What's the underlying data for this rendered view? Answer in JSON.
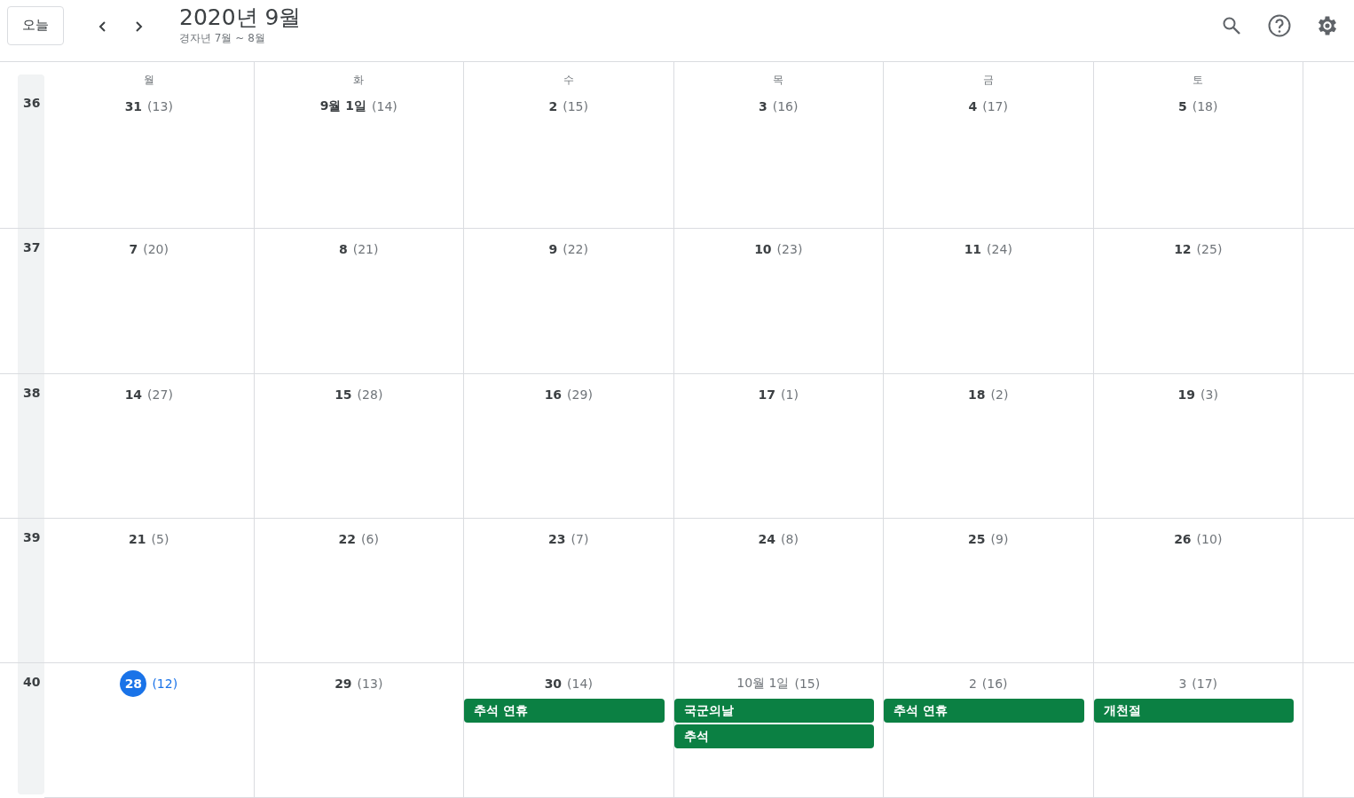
{
  "toolbar": {
    "today_button": "오늘",
    "title": "2020년 9월",
    "subtitle": "경자년 7월 ~ 8월"
  },
  "weekdays": [
    "월",
    "화",
    "수",
    "목",
    "금",
    "토"
  ],
  "weeks": [
    {
      "number": "36",
      "days": [
        {
          "day": "31",
          "lunar": "(13)",
          "today": false,
          "other_month": false
        },
        {
          "day": "9월 1일",
          "lunar": "(14)",
          "today": false,
          "other_month": false
        },
        {
          "day": "2",
          "lunar": "(15)",
          "today": false,
          "other_month": false
        },
        {
          "day": "3",
          "lunar": "(16)",
          "today": false,
          "other_month": false
        },
        {
          "day": "4",
          "lunar": "(17)",
          "today": false,
          "other_month": false
        },
        {
          "day": "5",
          "lunar": "(18)",
          "today": false,
          "other_month": false
        }
      ]
    },
    {
      "number": "37",
      "days": [
        {
          "day": "7",
          "lunar": "(20)",
          "today": false,
          "other_month": false
        },
        {
          "day": "8",
          "lunar": "(21)",
          "today": false,
          "other_month": false
        },
        {
          "day": "9",
          "lunar": "(22)",
          "today": false,
          "other_month": false
        },
        {
          "day": "10",
          "lunar": "(23)",
          "today": false,
          "other_month": false
        },
        {
          "day": "11",
          "lunar": "(24)",
          "today": false,
          "other_month": false
        },
        {
          "day": "12",
          "lunar": "(25)",
          "today": false,
          "other_month": false
        }
      ]
    },
    {
      "number": "38",
      "days": [
        {
          "day": "14",
          "lunar": "(27)",
          "today": false,
          "other_month": false
        },
        {
          "day": "15",
          "lunar": "(28)",
          "today": false,
          "other_month": false
        },
        {
          "day": "16",
          "lunar": "(29)",
          "today": false,
          "other_month": false
        },
        {
          "day": "17",
          "lunar": "(1)",
          "today": false,
          "other_month": false
        },
        {
          "day": "18",
          "lunar": "(2)",
          "today": false,
          "other_month": false
        },
        {
          "day": "19",
          "lunar": "(3)",
          "today": false,
          "other_month": false
        }
      ]
    },
    {
      "number": "39",
      "days": [
        {
          "day": "21",
          "lunar": "(5)",
          "today": false,
          "other_month": false
        },
        {
          "day": "22",
          "lunar": "(6)",
          "today": false,
          "other_month": false
        },
        {
          "day": "23",
          "lunar": "(7)",
          "today": false,
          "other_month": false
        },
        {
          "day": "24",
          "lunar": "(8)",
          "today": false,
          "other_month": false
        },
        {
          "day": "25",
          "lunar": "(9)",
          "today": false,
          "other_month": false
        },
        {
          "day": "26",
          "lunar": "(10)",
          "today": false,
          "other_month": false
        }
      ]
    },
    {
      "number": "40",
      "days": [
        {
          "day": "28",
          "lunar": "(12)",
          "today": true,
          "other_month": false
        },
        {
          "day": "29",
          "lunar": "(13)",
          "today": false,
          "other_month": false
        },
        {
          "day": "30",
          "lunar": "(14)",
          "today": false,
          "other_month": false,
          "events": [
            {
              "title": "추석 연휴",
              "color": "#0b8043"
            }
          ]
        },
        {
          "day": "10월 1일",
          "lunar": "(15)",
          "today": false,
          "other_month": true,
          "events": [
            {
              "title": "국군의날",
              "color": "#0b8043"
            },
            {
              "title": "추석",
              "color": "#0b8043"
            }
          ]
        },
        {
          "day": "2",
          "lunar": "(16)",
          "today": false,
          "other_month": true,
          "events": [
            {
              "title": "추석 연휴",
              "color": "#0b8043"
            }
          ]
        },
        {
          "day": "3",
          "lunar": "(17)",
          "today": false,
          "other_month": true,
          "events": [
            {
              "title": "개천절",
              "color": "#0b8043"
            }
          ]
        }
      ]
    }
  ]
}
